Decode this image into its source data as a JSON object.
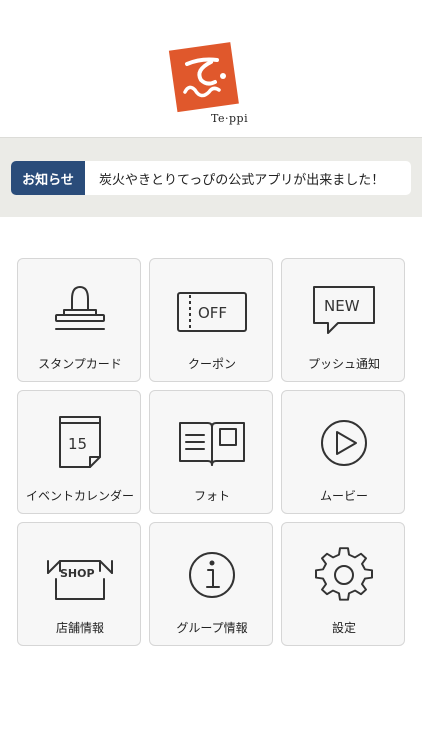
{
  "header": {
    "logo_text": "Te·ppi",
    "logo_color": "#e0582c"
  },
  "news": {
    "label": "お知らせ",
    "text": "炭火やきとりてっぴの公式アプリが出来ました！",
    "label_color": "#2a4c7a"
  },
  "menu": {
    "items": [
      {
        "label": "スタンプカード",
        "icon": "stamp-icon"
      },
      {
        "label": "クーポン",
        "icon": "coupon-icon"
      },
      {
        "label": "プッシュ通知",
        "icon": "new-bubble-icon"
      },
      {
        "label": "イベントカレンダー",
        "icon": "calendar-icon"
      },
      {
        "label": "フォト",
        "icon": "photo-book-icon"
      },
      {
        "label": "ムービー",
        "icon": "play-icon"
      },
      {
        "label": "店舗情報",
        "icon": "shop-icon"
      },
      {
        "label": "グループ情報",
        "icon": "info-icon"
      },
      {
        "label": "設定",
        "icon": "gear-icon"
      }
    ],
    "icon_texts": {
      "coupon": "OFF",
      "new": "NEW",
      "calendar_day": "15",
      "shop": "SHOP"
    }
  }
}
